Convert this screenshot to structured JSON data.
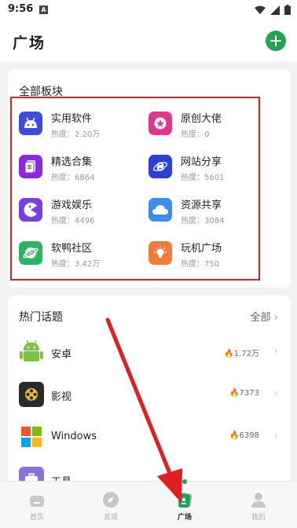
{
  "status_bar": {
    "time": "9:56",
    "notif_glyph": "A"
  },
  "header": {
    "title": "广场"
  },
  "boards": {
    "title": "全部板块",
    "items": [
      {
        "name": "实用软件",
        "heat": "热度：2.20万",
        "icon": "android-icon",
        "color": "#3d4be0"
      },
      {
        "name": "原创大佬",
        "heat": "热度：0",
        "icon": "star-badge-icon",
        "color": "#e0368c"
      },
      {
        "name": "精选合集",
        "heat": "热度：6864",
        "icon": "collection-icon",
        "color": "#8a2be2"
      },
      {
        "name": "网站分享",
        "heat": "热度：5601",
        "icon": "browser-e-icon",
        "color": "#2d3fd6"
      },
      {
        "name": "游戏娱乐",
        "heat": "热度：4496",
        "icon": "pacman-icon",
        "color": "#7a3fe0"
      },
      {
        "name": "资源共享",
        "heat": "热度：3084",
        "icon": "cloud-icon",
        "color": "#3b8df0"
      },
      {
        "name": "软鸭社区",
        "heat": "热度：3.42万",
        "icon": "planet-icon",
        "color": "#2bb561"
      },
      {
        "name": "玩机广场",
        "heat": "热度：750",
        "icon": "bulb-icon",
        "color": "#f5793a"
      }
    ]
  },
  "topics": {
    "title": "热门话题",
    "all_label": "全部",
    "items": [
      {
        "name": "安卓",
        "heat": "1.72万",
        "icon": "android-robot-icon"
      },
      {
        "name": "影视",
        "heat": "7373",
        "icon": "film-reel-icon"
      },
      {
        "name": "Windows",
        "heat": "6398",
        "icon": "windows-logo-icon"
      },
      {
        "name": "工具",
        "heat": "",
        "icon": "toolbox-icon"
      }
    ]
  },
  "tabs": [
    {
      "label": "首页",
      "icon": "home-icon"
    },
    {
      "label": "发现",
      "icon": "compass-icon"
    },
    {
      "label": "广场",
      "icon": "plaza-icon",
      "active": true
    },
    {
      "label": "我的",
      "icon": "user-icon"
    }
  ],
  "colors": {
    "accent": "#22a354",
    "annotation_red": "#e02020"
  }
}
